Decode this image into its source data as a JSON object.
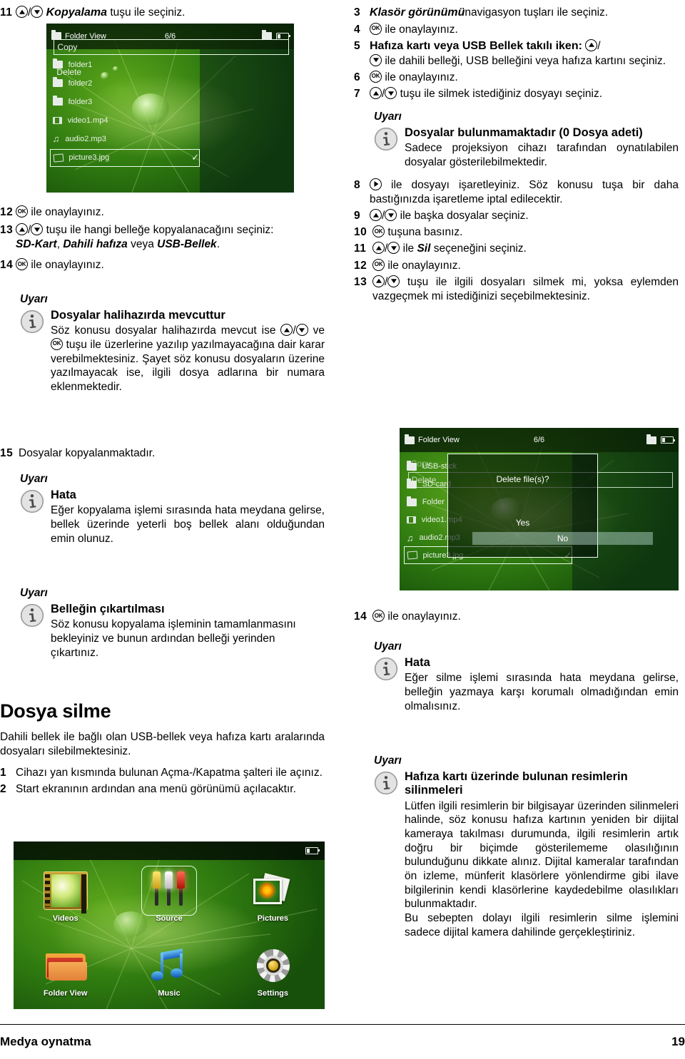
{
  "footer": {
    "title": "Medya oynatma",
    "page": "19"
  },
  "labels": {
    "uyari": "Uyarı"
  },
  "left_column": {
    "steps_top": [
      {
        "num": "11",
        "keys": "up-down",
        "text_bold_italic": "Kopyalama",
        "text_after": " tuşu ile seçiniz."
      }
    ],
    "step11": {
      "num": "11",
      "emph": "Kopyalama",
      "rest": "tuşu ile seçiniz."
    },
    "screenshot_copy": {
      "title": "Folder View",
      "count": "6/6",
      "files": [
        "folder1",
        "folder2",
        "folder3",
        "video1.mp4",
        "audio2.mp3",
        "picture3.jpg"
      ],
      "panel": [
        "Copy",
        "Delete"
      ],
      "selected_file": "picture3.jpg",
      "selected_panel": "Copy",
      "check": "✓"
    },
    "step12": {
      "num": "12",
      "rest": "ile onaylayınız."
    },
    "step13": {
      "num": "13",
      "rest_a": "tuşu ile hangi belleğe kopyalanacağını seçiniz:",
      "opt1": "SD-Kart",
      "sep1": ", ",
      "opt2": "Dahili hafıza",
      "sep2": " veya ",
      "opt3": "USB-Bellek",
      "end": "."
    },
    "step14": {
      "num": "14",
      "rest": "ile onaylayınız."
    },
    "note_exists": {
      "label": "Uyarı",
      "title": "Dosyalar halihazırda mevcuttur",
      "text_a": "Söz konusu dosyalar halihazırda mevcut ise",
      "text_b": "ve",
      "text_c": "tuşu ile üzerlerine yazılıp yazılmayacağına dair karar verebilmektesiniz. Şayet söz konusu dosyaların üzerine yazılmayacak ise, ilgili dosya adlarına bir numara eklenmektedir."
    },
    "step15": {
      "num": "15",
      "rest": "Dosyalar kopyalanmaktadır."
    },
    "note_error_copy": {
      "label": "Uyarı",
      "title": "Hata",
      "text": "Eğer kopyalama işlemi sırasında hata meydana gelirse, bellek üzerinde yeterli boş bellek alanı olduğundan emin olunuz."
    },
    "note_eject": {
      "label": "Uyarı",
      "title": "Belleğin çıkartılması",
      "text": "Söz konusu kopyalama işleminin tamamlanmasını bekleyiniz ve bunun ardından belleği yerinden çıkartınız."
    },
    "section_title": "Dosya silme",
    "section_intro": "Dahili bellek ile bağlı olan USB-bellek veya hafıza kartı aralarında dosyaları silebilmektesiniz.",
    "step_1": {
      "num": "1",
      "text": "Cihazı yan kısmında bulunan Açma-/Kapatma şalteri ile açınız."
    },
    "step_2": {
      "num": "2",
      "text": "Start ekranının ardından ana menü görünümü açılacaktır."
    },
    "main_menu": {
      "items": [
        {
          "label": "Videos",
          "icon": "video-icon",
          "selected": false
        },
        {
          "label": "Source",
          "icon": "rca-source-icon",
          "selected": true
        },
        {
          "label": "Pictures",
          "icon": "pictures-icon",
          "selected": false
        },
        {
          "label": "Folder View",
          "icon": "folder-icon",
          "selected": false
        },
        {
          "label": "Music",
          "icon": "music-note-icon",
          "selected": false
        },
        {
          "label": "Settings",
          "icon": "gear-icon",
          "selected": false
        }
      ]
    }
  },
  "right_column": {
    "step3": {
      "num": "3",
      "emph": "Klasör görünümü",
      "rest": "navigasyon tuşları ile seçiniz."
    },
    "step4": {
      "num": "4",
      "rest": "ile onaylayınız."
    },
    "step5": {
      "num": "5",
      "bold": "Hafıza kartı veya USB Bellek takılı iken:",
      "rest": "ile dahili belleği, USB belleğini veya hafıza kartını seçiniz."
    },
    "step6": {
      "num": "6",
      "rest": "ile onaylayınız."
    },
    "step7": {
      "num": "7",
      "rest": "tuşu ile silmek istediğiniz dosyayı seçiniz."
    },
    "note_nofiles": {
      "label": "Uyarı",
      "title": "Dosyalar bulunmamaktadır (0 Dosya adeti)",
      "text": "Sadece projeksiyon cihazı tarafından oynatılabilen dosyalar gösterilebilmektedir."
    },
    "step8": {
      "num": "8",
      "rest": "ile dosyayı işaretleyiniz. Söz konusu tuşa bir daha bastığınızda işaretleme iptal edilecektir."
    },
    "step9": {
      "num": "9",
      "rest": "ile başka dosyalar seçiniz."
    },
    "step10": {
      "num": "10",
      "rest": "tuşuna basınız."
    },
    "step11": {
      "num": "11",
      "rest_a": "ile",
      "emph": "Sil",
      "rest_b": "seçeneğini seçiniz."
    },
    "step12": {
      "num": "12",
      "rest": "ile onaylayınız."
    },
    "step13": {
      "num": "13",
      "rest": "tuşu ile ilgili dosyaları silmek mi, yoksa eylemden vazgeçmek mi istediğinizi seçebilmektesiniz."
    },
    "screenshot_delete": {
      "title": "Folder View",
      "count": "6/6",
      "files": [
        "USB-stick",
        "SD-card",
        "Folder",
        "video1.mp4",
        "audio2.mp3",
        "picture3.jpg"
      ],
      "panel": [
        "Copy",
        "Delete"
      ],
      "selected_panel": "Delete",
      "selected_file": "picture3.jpg",
      "dialog_question": "Delete file(s)?",
      "dialog_yes": "Yes",
      "dialog_no": "No",
      "check": "✓"
    },
    "step14": {
      "num": "14",
      "rest": "ile onaylayınız."
    },
    "note_error_delete": {
      "label": "Uyarı",
      "title": "Hata",
      "text": "Eğer silme işlemi sırasında hata meydana gelirse, belleğin yazmaya karşı korumalı olmadığından emin olmalısınız."
    },
    "note_card_pics": {
      "label": "Uyarı",
      "title": "Hafıza kartı üzerinde bulunan resimlerin silinmeleri",
      "text_p1": "Lütfen ilgili resimlerin bir bilgisayar üzerinden silinmeleri halinde, söz konusu hafıza kartının yeniden bir dijital kameraya takılması durumunda, ilgili resimlerin artık doğru bir biçimde gösterilememe olasılığının bulunduğunu dikkate alınız. Dijital kameralar tarafından ön izleme, münferit klasörlere yönlendirme gibi ilave bilgilerinin kendi klasörlerine kaydedebilme olasılıkları bulunmaktadır.",
      "text_p2": "Bu sebepten dolayı ilgili resimlerin silme işlemini sadece dijital kamera dahilinde gerçekleştiriniz."
    }
  }
}
